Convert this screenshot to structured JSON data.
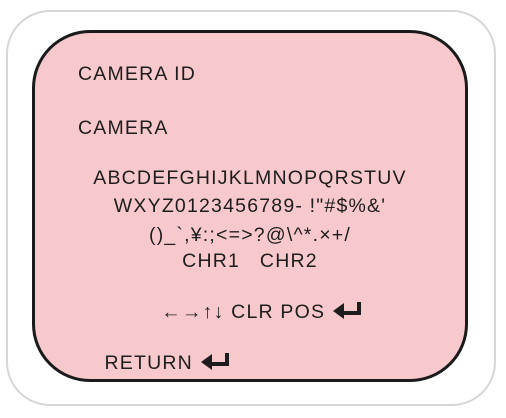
{
  "menu": {
    "title": "CAMERA ID",
    "camera_id_value": "CAMERA",
    "character_rows": [
      "ABCDEFGHIJKLMNOPQRSTUV",
      "WXYZ0123456789- !\"#$%&'",
      "()_`,¥:;<=>?@\\^*.×+/",
      "CHR1   CHR2"
    ],
    "cursor_row": "←→↑↓ CLR POS",
    "return_label": "RETURN"
  },
  "colors": {
    "screen_background": "#f8c9cc",
    "text": "#1d1d1d",
    "outer_frame": "#d6d6d6"
  },
  "icons": [
    "enter-arrow-icon",
    "enter-arrow-icon"
  ]
}
